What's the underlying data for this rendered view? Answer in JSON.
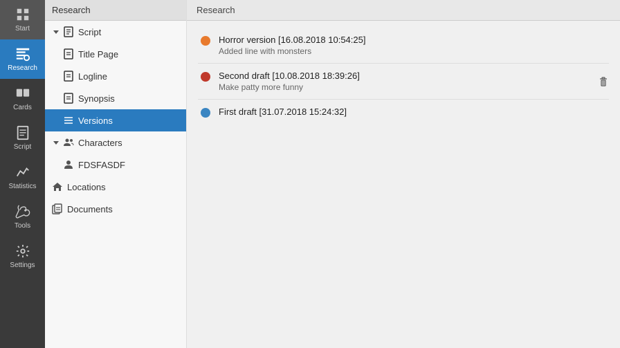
{
  "iconBar": {
    "items": [
      {
        "id": "start",
        "label": "Start",
        "icon": "grid"
      },
      {
        "id": "research",
        "label": "Research",
        "icon": "research",
        "active": true
      },
      {
        "id": "cards",
        "label": "Cards",
        "icon": "cards"
      },
      {
        "id": "script",
        "label": "Script",
        "icon": "script"
      },
      {
        "id": "statistics",
        "label": "Statistics",
        "icon": "statistics"
      },
      {
        "id": "tools",
        "label": "Tools",
        "icon": "tools"
      },
      {
        "id": "settings",
        "label": "Settings",
        "icon": "settings"
      }
    ]
  },
  "sidebar": {
    "header": "Research",
    "tree": [
      {
        "id": "script",
        "label": "Script",
        "type": "group",
        "icon": "script",
        "expanded": true,
        "indent": 0
      },
      {
        "id": "title-page",
        "label": "Title Page",
        "type": "item",
        "icon": "doc",
        "indent": 1
      },
      {
        "id": "logline",
        "label": "Logline",
        "type": "item",
        "icon": "doc",
        "indent": 1
      },
      {
        "id": "synopsis",
        "label": "Synopsis",
        "type": "item",
        "icon": "doc",
        "indent": 1
      },
      {
        "id": "versions",
        "label": "Versions",
        "type": "item",
        "icon": "list",
        "indent": 1,
        "active": true
      },
      {
        "id": "characters",
        "label": "Characters",
        "type": "group",
        "icon": "people",
        "expanded": true,
        "indent": 0
      },
      {
        "id": "fdsfasdf",
        "label": "FDSFASDF",
        "type": "item",
        "icon": "person",
        "indent": 1
      },
      {
        "id": "locations",
        "label": "Locations",
        "type": "item",
        "icon": "home",
        "indent": 0
      },
      {
        "id": "documents",
        "label": "Documents",
        "type": "item",
        "icon": "docs",
        "indent": 0
      }
    ]
  },
  "main": {
    "header": "Research",
    "versions": [
      {
        "id": "v1",
        "title": "Horror version [16.08.2018 10:54:25]",
        "subtitle": "Added line with monsters",
        "color": "#e87a2d",
        "showDelete": false
      },
      {
        "id": "v2",
        "title": "Second draft [10.08.2018 18:39:26]",
        "subtitle": "Make patty more funny",
        "color": "#c0392b",
        "showDelete": true
      },
      {
        "id": "v3",
        "title": "First draft [31.07.2018 15:24:32]",
        "subtitle": "",
        "color": "#3a85c2",
        "showDelete": false
      }
    ]
  }
}
